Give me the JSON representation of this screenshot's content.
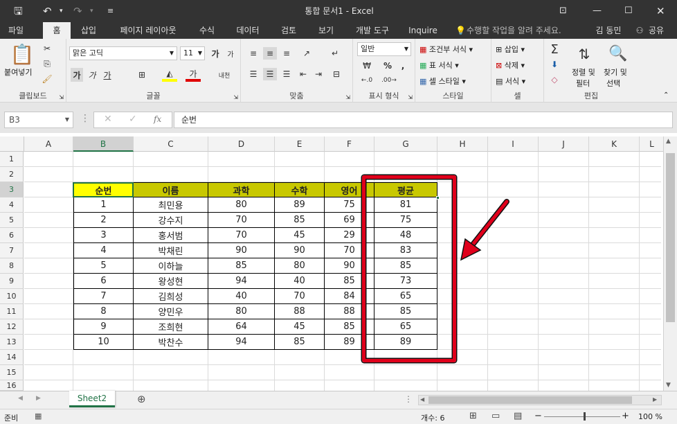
{
  "window": {
    "title": "통합 문서1 - Excel",
    "user": "김 동민",
    "share": "공유"
  },
  "ribbon_tabs": [
    "파일",
    "홈",
    "삽입",
    "페이지 레이아웃",
    "수식",
    "데이터",
    "검토",
    "보기",
    "개발 도구",
    "Inquire"
  ],
  "tell_me": "수행할 작업을 알려 주세요.",
  "ribbon": {
    "clipboard": {
      "paste": "붙여넣기",
      "label": "클립보드"
    },
    "font": {
      "name": "맑은 고딕",
      "size": "11",
      "bold": "가",
      "italic": "가",
      "underline": "가",
      "fontcolor": "가",
      "label": "글꼴"
    },
    "align": {
      "label": "맞춤"
    },
    "number": {
      "format": "일반",
      "percent": "%",
      "comma": ",",
      "label": "표시 형식"
    },
    "styles": {
      "conditional": "조건부 서식",
      "table": "표 서식",
      "cell": "셀 스타일",
      "label": "스타일"
    },
    "cells": {
      "insert": "삽입",
      "delete": "삭제",
      "format": "서식",
      "label": "셀"
    },
    "editing": {
      "sort1": "정렬 및",
      "sort2": "필터",
      "find1": "찾기 및",
      "find2": "선택",
      "label": "편집"
    }
  },
  "formula_bar": {
    "name_box": "B3",
    "fx": "fx",
    "value": "순번"
  },
  "columns": [
    "A",
    "B",
    "C",
    "D",
    "E",
    "F",
    "G",
    "H",
    "I",
    "J",
    "K",
    "L"
  ],
  "rows": [
    "1",
    "2",
    "3",
    "4",
    "5",
    "6",
    "7",
    "8",
    "9",
    "10",
    "11",
    "12",
    "13",
    "14",
    "15",
    "16"
  ],
  "table": {
    "headers": [
      "순번",
      "이름",
      "과학",
      "수학",
      "영어",
      "평균"
    ],
    "rows": [
      [
        "1",
        "최민용",
        "80",
        "89",
        "75",
        "81"
      ],
      [
        "2",
        "강수지",
        "70",
        "85",
        "69",
        "75"
      ],
      [
        "3",
        "홍서범",
        "70",
        "45",
        "29",
        "48"
      ],
      [
        "4",
        "박채린",
        "90",
        "90",
        "70",
        "83"
      ],
      [
        "5",
        "이하늘",
        "85",
        "80",
        "90",
        "85"
      ],
      [
        "6",
        "왕성현",
        "94",
        "40",
        "85",
        "73"
      ],
      [
        "7",
        "김희성",
        "40",
        "70",
        "84",
        "65"
      ],
      [
        "8",
        "양민우",
        "80",
        "88",
        "88",
        "85"
      ],
      [
        "9",
        "조희현",
        "64",
        "45",
        "85",
        "65"
      ],
      [
        "10",
        "박찬수",
        "94",
        "85",
        "89",
        "89"
      ]
    ]
  },
  "sheet_tabs": [
    "Sheet2"
  ],
  "status": {
    "ready": "준비",
    "count": "개수: 6",
    "zoom": "100 %"
  },
  "colors": {
    "header_fill": "#c8c800",
    "header_first_fill": "#ffff00",
    "highlight": "#e0001b",
    "excel_green": "#217346"
  }
}
